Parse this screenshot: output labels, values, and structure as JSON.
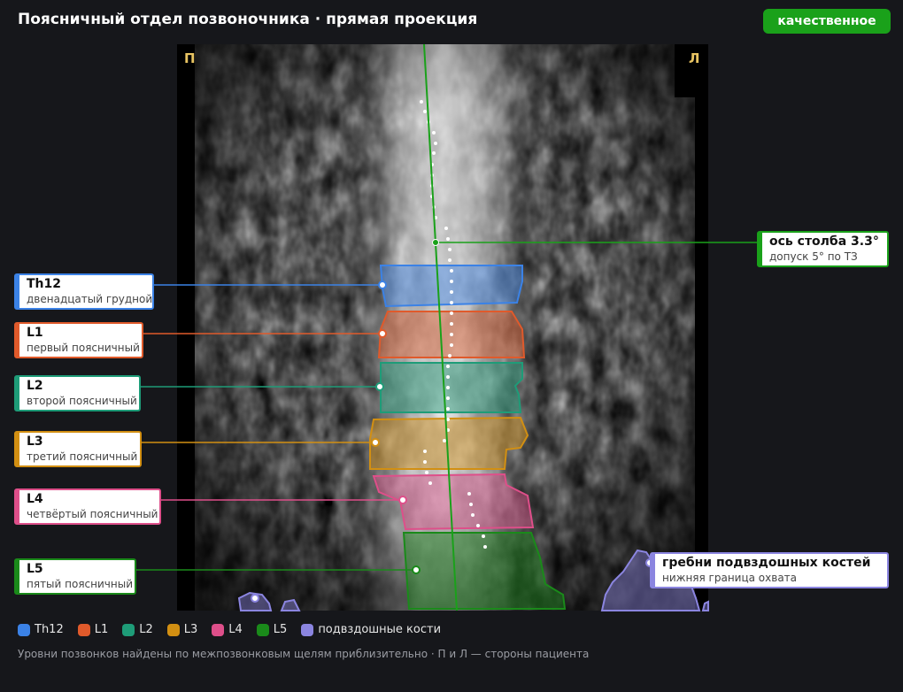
{
  "header": {
    "title": "Поясничный отдел позвоночника · прямая проекция",
    "quality_badge": "качественное"
  },
  "scan": {
    "side_right_marker": "П",
    "side_left_marker": "Л",
    "axis_color": "#1aa11a"
  },
  "axis_callout": {
    "name": "ось столба 3.3°",
    "sub": "допуск 5° по ТЗ",
    "color": "#1aa11a"
  },
  "vertebrae": [
    {
      "name": "Th12",
      "sub": "двенадцатый грудной",
      "color": "#3b82e6"
    },
    {
      "name": "L1",
      "sub": "первый поясничный",
      "color": "#e05a2b"
    },
    {
      "name": "L2",
      "sub": "второй поясничный",
      "color": "#1e9c78"
    },
    {
      "name": "L3",
      "sub": "третий поясничный",
      "color": "#d28f12"
    },
    {
      "name": "L4",
      "sub": "четвёртый поясничный",
      "color": "#de4f8a"
    },
    {
      "name": "L5",
      "sub": "пятый поясничный",
      "color": "#1a8a1a"
    }
  ],
  "iliac_callout": {
    "name": "гребни подвздошных костей",
    "sub": "нижняя граница охвата",
    "color": "#8b85e0"
  },
  "legend": [
    {
      "label": "Th12",
      "color": "#3b82e6"
    },
    {
      "label": "L1",
      "color": "#e05a2b"
    },
    {
      "label": "L2",
      "color": "#1e9c78"
    },
    {
      "label": "L3",
      "color": "#d28f12"
    },
    {
      "label": "L4",
      "color": "#de4f8a"
    },
    {
      "label": "L5",
      "color": "#1a8a1a"
    },
    {
      "label": "подвздошные кости",
      "color": "#8b85e0"
    }
  ],
  "footnote": "Уровни позвонков найдены по межпозвонковым щелям приблизительно · П и Л — стороны пациента"
}
